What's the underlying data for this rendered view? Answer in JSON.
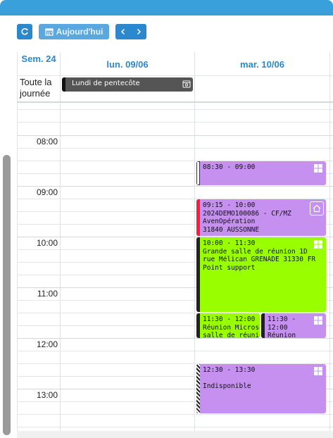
{
  "toolbar": {
    "today_label": "Aujourd'hui",
    "icons": [
      "refresh-icon",
      "calendar-icon",
      "chevron-left-icon",
      "chevron-right-icon"
    ]
  },
  "week": {
    "label": "Sem. 24",
    "days": [
      "lun. 09/06",
      "mar. 10/06"
    ],
    "all_day_label": "Toute la journée",
    "all_day_events": [
      {
        "title": "Lundi de pentecôte",
        "color": "#555555"
      }
    ]
  },
  "times": [
    "08:00",
    "09:00",
    "10:00",
    "11:00",
    "12:00",
    "13:00"
  ],
  "events": [
    {
      "id": "ev1",
      "time": "08:30 - 09:00",
      "lines": [],
      "color": "#c690f0",
      "bar": "#ffffff",
      "icon": "windows-icon"
    },
    {
      "id": "ev2",
      "time": "09:15 - 10:00",
      "lines": [
        "2024DEMO100086 - CF/MZ",
        "AvenOpération",
        "31840 AUSSONNE"
      ],
      "color": "#c690f0",
      "bar": "#ff1a40",
      "icon": "home-icon"
    },
    {
      "id": "ev3",
      "time": "10:00 - 11:30",
      "lines": [
        "Grande salle de réunion 1D",
        "rue Mélican GRENADE 31330 FR",
        "Point support"
      ],
      "color": "#99ff00",
      "bar": "#222222",
      "icon": "windows-icon"
    },
    {
      "id": "ev4",
      "time": "11:30 - 12:00",
      "lines": [
        "Réunion Microsoft",
        "salle de réunion"
      ],
      "color": "#99ff00",
      "bar": "#222222",
      "icon": ""
    },
    {
      "id": "ev5",
      "time": "11:30 - 12:00",
      "lines": [
        "Réunion"
      ],
      "color": "#c690f0",
      "bar": "#222222",
      "icon": "windows-icon"
    },
    {
      "id": "ev6",
      "time": "12:30 - 13:30",
      "lines": [
        "",
        "Indisponible"
      ],
      "color": "#c690f0",
      "bar": "dotted",
      "icon": "windows-icon"
    }
  ],
  "colors": {
    "accent": "#2b88cc",
    "header": "#3aa0dc"
  }
}
